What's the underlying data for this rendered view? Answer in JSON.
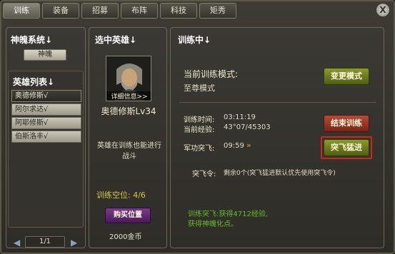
{
  "tabs": [
    "训练",
    "装备",
    "招募",
    "布阵",
    "科技",
    "矩秀"
  ],
  "close_label": "X",
  "left": {
    "spirit_title": "神魄系统↓",
    "spirit_button": "神魄",
    "hero_list_title": "英雄列表↓",
    "heroes": [
      "奥德修斯√",
      "阿尔求达√",
      "阿耶修斯√",
      "伯斯洛丰√"
    ],
    "pager": "1/1"
  },
  "middle": {
    "title": "选中英雄↓",
    "detail_label": "详细信息>>",
    "hero_name": "奥德修斯Lv34",
    "note": "英雄在训练也能进行战斗",
    "slots_label": "训练空位: 4/6",
    "buy_button": "购买位置",
    "price": "2000金币"
  },
  "right": {
    "title": "训练中↓",
    "mode_label": "当前训练模式:",
    "mode_value": "至尊模式",
    "change_mode_button": "变更模式",
    "time_label": "训练时间:",
    "time_value": "03:11:19",
    "exp_label": "当前经验:",
    "exp_value": "43°07/45303",
    "end_button": "结束训练",
    "medal_label": "军功突飞:",
    "medal_value": "09:59",
    "breakthrough_button": "突飞猛进",
    "order_label": "突飞令:",
    "order_value": "剩余0个(突飞猛进默认优先使用突飞令)",
    "train_note_1": "训练突飞:获得4712经验,",
    "train_note_2": "获得神魄化点。"
  }
}
